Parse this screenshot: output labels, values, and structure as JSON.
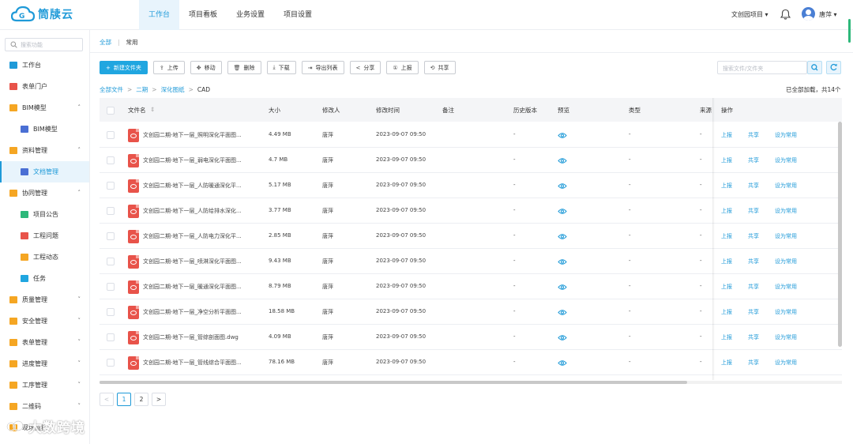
{
  "app": {
    "logo_text": "筒牍云"
  },
  "topnav": {
    "tabs": [
      {
        "label": "工作台",
        "active": true
      },
      {
        "label": "项目看板",
        "active": false
      },
      {
        "label": "业务设置",
        "active": false
      },
      {
        "label": "项目设置",
        "active": false
      }
    ],
    "project": "文创园项目 ▾",
    "user": "唐萍 ▾"
  },
  "sidebar": {
    "search_placeholder": "搜索功能",
    "items": [
      {
        "label": "工作台",
        "icon": "dashboard-icon",
        "color": "#1f9ad8",
        "sub": false,
        "caret": ""
      },
      {
        "label": "表单门户",
        "icon": "form-icon",
        "color": "#e8534a",
        "sub": false,
        "caret": ""
      },
      {
        "label": "BIM模型",
        "icon": "folder-icon",
        "color": "#f5a623",
        "sub": false,
        "caret": "˄"
      },
      {
        "label": "BIM模型",
        "icon": "model-icon",
        "color": "#4a6fd4",
        "sub": true,
        "caret": ""
      },
      {
        "label": "资料管理",
        "icon": "folder-icon",
        "color": "#f5a623",
        "sub": false,
        "caret": "˄"
      },
      {
        "label": "文档管理",
        "icon": "document-icon",
        "color": "#4a6fd4",
        "sub": true,
        "caret": "",
        "active": true
      },
      {
        "label": "协同管理",
        "icon": "folder-icon",
        "color": "#f5a623",
        "sub": false,
        "caret": "˄"
      },
      {
        "label": "项目公告",
        "icon": "announcement-icon",
        "color": "#2db87a",
        "sub": true,
        "caret": ""
      },
      {
        "label": "工程问题",
        "icon": "issue-icon",
        "color": "#e8534a",
        "sub": true,
        "caret": ""
      },
      {
        "label": "工程动态",
        "icon": "news-icon",
        "color": "#f5a623",
        "sub": true,
        "caret": ""
      },
      {
        "label": "任务",
        "icon": "task-icon",
        "color": "#20a6e0",
        "sub": true,
        "caret": ""
      },
      {
        "label": "质量管理",
        "icon": "folder-icon",
        "color": "#f5a623",
        "sub": false,
        "caret": "˅"
      },
      {
        "label": "安全管理",
        "icon": "folder-icon",
        "color": "#f5a623",
        "sub": false,
        "caret": "˅"
      },
      {
        "label": "表单管理",
        "icon": "folder-icon",
        "color": "#f5a623",
        "sub": false,
        "caret": "˅"
      },
      {
        "label": "进度管理",
        "icon": "folder-icon",
        "color": "#f5a623",
        "sub": false,
        "caret": "˅"
      },
      {
        "label": "工序管理",
        "icon": "folder-icon",
        "color": "#f5a623",
        "sub": false,
        "caret": "˅"
      },
      {
        "label": "二维码",
        "icon": "folder-icon",
        "color": "#f5a623",
        "sub": false,
        "caret": "˅"
      },
      {
        "label": "现场监控",
        "icon": "folder-icon",
        "color": "#f5a623",
        "sub": false,
        "caret": ""
      }
    ]
  },
  "breadcrumb_top": {
    "root": "全部",
    "current": "常用"
  },
  "toolbar": {
    "buttons": [
      {
        "label": "新建文件夹",
        "icon": "+",
        "primary": true,
        "name": "new-folder-button"
      },
      {
        "label": "上传",
        "icon": "⇪",
        "primary": false,
        "name": "upload-button"
      },
      {
        "label": "移动",
        "icon": "✥",
        "primary": false,
        "name": "move-button"
      },
      {
        "label": "删除",
        "icon": "🗑",
        "primary": false,
        "name": "delete-button"
      },
      {
        "label": "下载",
        "icon": "⤓",
        "primary": false,
        "name": "download-button"
      },
      {
        "label": "导出列表",
        "icon": "⇥",
        "primary": false,
        "name": "export-list-button"
      },
      {
        "label": "分享",
        "icon": "<",
        "primary": false,
        "name": "share-button"
      },
      {
        "label": "上报",
        "icon": "①",
        "primary": false,
        "name": "report-button"
      },
      {
        "label": "共享",
        "icon": "⟲",
        "primary": false,
        "name": "co-share-button"
      }
    ],
    "search_placeholder": "搜索文件/文件夹"
  },
  "path": {
    "items": [
      "全部文件",
      "二期",
      "深化图纸"
    ],
    "current": "CAD"
  },
  "load_info": "已全部加载，共14个",
  "table": {
    "columns": [
      "文件名",
      "大小",
      "修改人",
      "修改时间",
      "备注",
      "历史版本",
      "预览",
      "类型",
      "来源",
      "操作"
    ],
    "sort_icon": "⇕",
    "actions": [
      "上报",
      "共享",
      "设为常用"
    ],
    "rows": [
      {
        "name": "文创园二期-地下一层_照明深化平面图...",
        "size": "4.49 MB",
        "modifier": "唐萍",
        "time": "2023-09-07 09:50",
        "version": "-",
        "type": "-",
        "source": "-"
      },
      {
        "name": "文创园二期-地下一层_弱电深化平面图...",
        "size": "4.7 MB",
        "modifier": "唐萍",
        "time": "2023-09-07 09:50",
        "version": "-",
        "type": "-",
        "source": "-"
      },
      {
        "name": "文创园二期-地下一层_人防暖通深化平...",
        "size": "5.17 MB",
        "modifier": "唐萍",
        "time": "2023-09-07 09:50",
        "version": "-",
        "type": "-",
        "source": "-"
      },
      {
        "name": "文创园二期-地下一层_人防给排水深化...",
        "size": "3.77 MB",
        "modifier": "唐萍",
        "time": "2023-09-07 09:50",
        "version": "-",
        "type": "-",
        "source": "-"
      },
      {
        "name": "文创园二期-地下一层_人防电力深化平...",
        "size": "2.85 MB",
        "modifier": "唐萍",
        "time": "2023-09-07 09:50",
        "version": "-",
        "type": "-",
        "source": "-"
      },
      {
        "name": "文创园二期-地下一层_喷淋深化平面图...",
        "size": "9.43 MB",
        "modifier": "唐萍",
        "time": "2023-09-07 09:50",
        "version": "-",
        "type": "-",
        "source": "-"
      },
      {
        "name": "文创园二期-地下一层_暖通深化平面图...",
        "size": "8.79 MB",
        "modifier": "唐萍",
        "time": "2023-09-07 09:50",
        "version": "-",
        "type": "-",
        "source": "-"
      },
      {
        "name": "文创园二期-地下一层_净空分析平面图...",
        "size": "18.58 MB",
        "modifier": "唐萍",
        "time": "2023-09-07 09:50",
        "version": "-",
        "type": "-",
        "source": "-"
      },
      {
        "name": "文创园二期-地下一层_管综剖面图.dwg",
        "size": "4.09 MB",
        "modifier": "唐萍",
        "time": "2023-09-07 09:50",
        "version": "-",
        "type": "-",
        "source": "-"
      },
      {
        "name": "文创园二期-地下一层_管线综合平面图...",
        "size": "78.16 MB",
        "modifier": "唐萍",
        "time": "2023-09-07 09:50",
        "version": "-",
        "type": "-",
        "source": "-"
      }
    ]
  },
  "pager": {
    "prev": "<",
    "pages": [
      "1",
      "2"
    ],
    "next": ">",
    "active": "1"
  },
  "watermark": "大数跨境"
}
